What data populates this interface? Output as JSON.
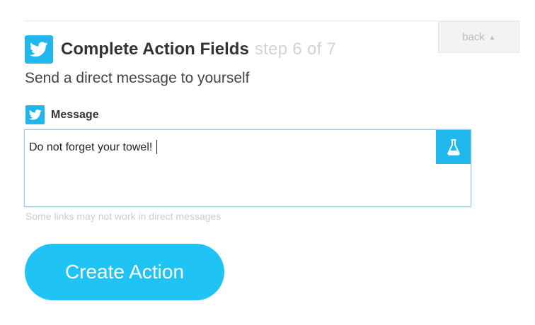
{
  "nav": {
    "back_label": "back",
    "back_caret": "▲"
  },
  "header": {
    "title": "Complete Action Fields",
    "step": "step 6 of 7",
    "icon": "twitter-bird-icon"
  },
  "action": {
    "description": "Send a direct message to yourself"
  },
  "field": {
    "label": "Message",
    "value": "Do not forget your towel!",
    "hint": "Some links may not work in direct messages",
    "ingredient_icon": "flask-icon"
  },
  "submit": {
    "label": "Create Action"
  },
  "colors": {
    "brand": "#1fb7ec",
    "button": "#1fc4f5",
    "muted": "#d3d3d3"
  }
}
